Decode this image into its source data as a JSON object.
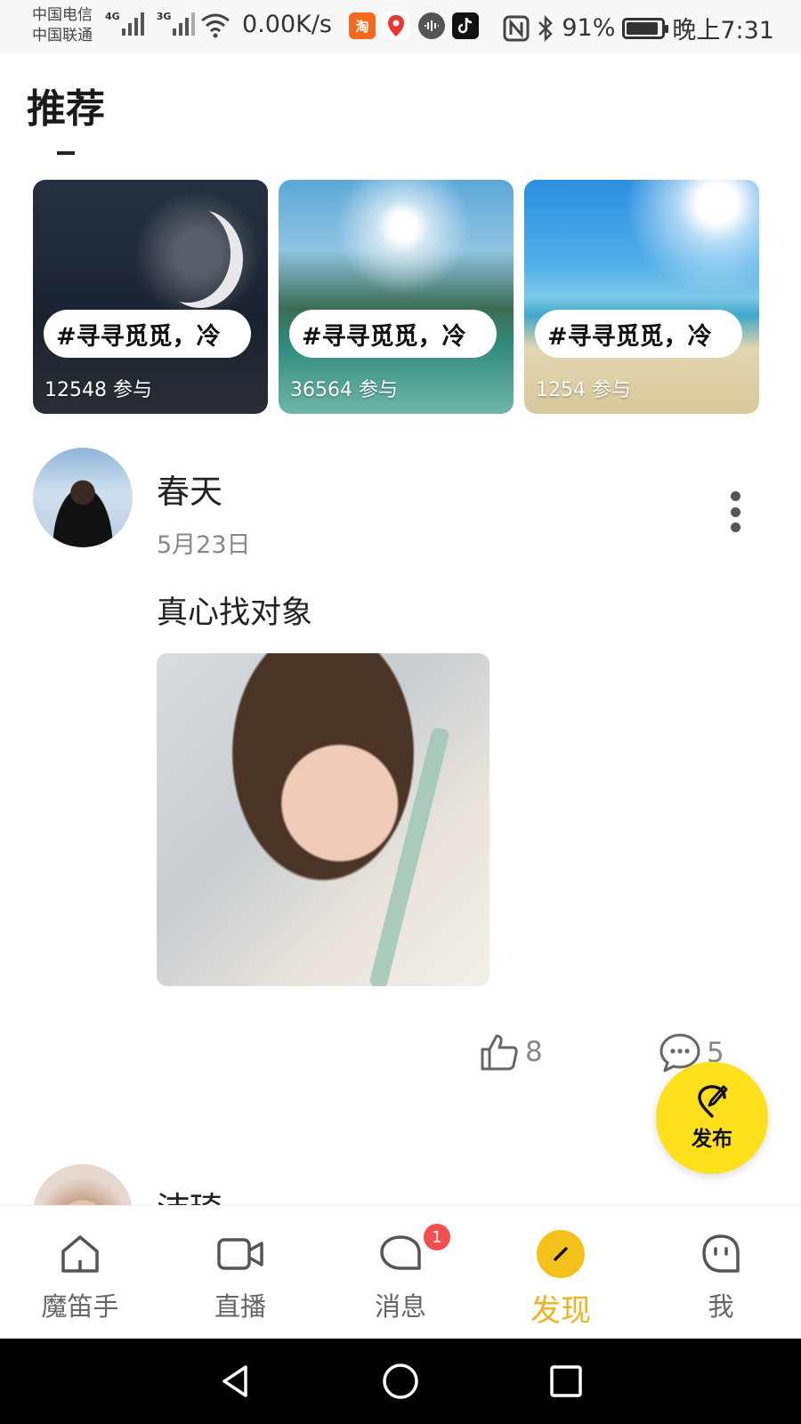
{
  "status_bar": {
    "carrier_1": "中国电信",
    "carrier_2": "中国联通",
    "net_1": "4G",
    "net_2": "3G",
    "speed": "0.00K/s",
    "app_icons": [
      "taobao-icon",
      "location-icon",
      "music-icon",
      "tiktok-icon"
    ],
    "taobao_label": "淘",
    "battery": "91%",
    "battery_level": 0.91,
    "time": "晚上7:31"
  },
  "recommend": {
    "title": "推荐",
    "topics": [
      {
        "label": "#寻寻觅觅，冷",
        "count": "12548 参与"
      },
      {
        "label": "#寻寻觅觅，冷",
        "count": "36564 参与"
      },
      {
        "label": "#寻寻觅觅，冷",
        "count": "1254 参与"
      }
    ]
  },
  "post": {
    "author": "春天",
    "date": "5月23日",
    "text": "真心找对象",
    "likes": "8",
    "comments": "5"
  },
  "next_post": {
    "author": "沛琦"
  },
  "fab": {
    "label": "发布"
  },
  "bottom_nav": {
    "items": [
      {
        "label": "魔笛手",
        "icon": "home-icon"
      },
      {
        "label": "直播",
        "icon": "video-camera-icon"
      },
      {
        "label": "消息",
        "icon": "message-icon",
        "badge": "1"
      },
      {
        "label": "发现",
        "icon": "discover-icon",
        "active": true
      },
      {
        "label": "我",
        "icon": "profile-face-icon"
      }
    ]
  },
  "colors": {
    "accent": "#f2b31a",
    "fab": "#ffe01b",
    "badge": "#f24e4e"
  }
}
